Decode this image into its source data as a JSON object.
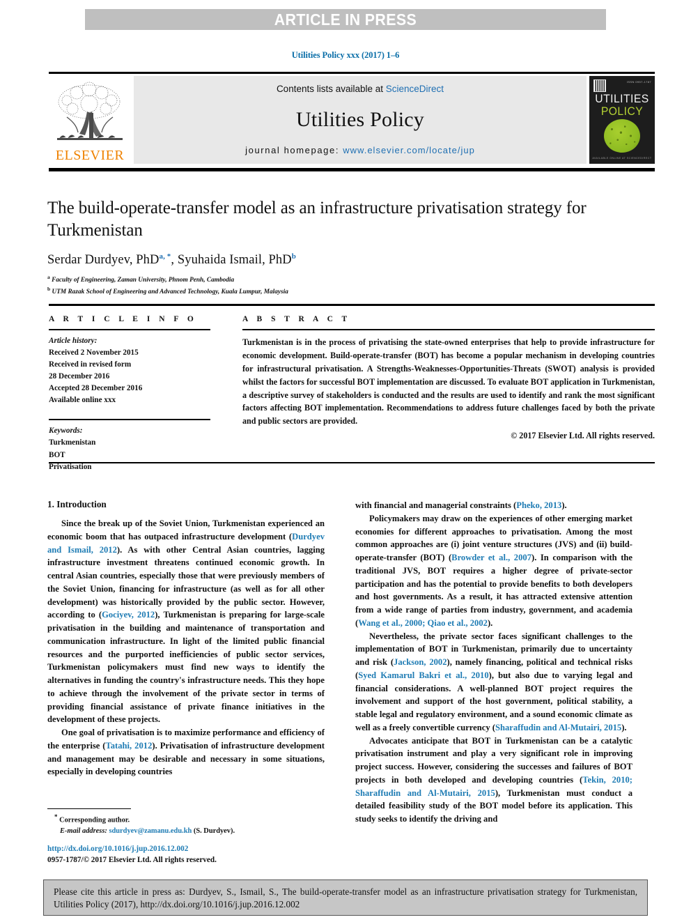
{
  "banner": {
    "text": "ARTICLE IN PRESS"
  },
  "journal_ref": "Utilities Policy xxx (2017) 1–6",
  "masthead": {
    "contents_prefix": "Contents lists available at ",
    "sciencedirect": "ScienceDirect",
    "journal_title": "Utilities Policy",
    "homepage_prefix": "journal homepage: ",
    "homepage_url": "www.elsevier.com/locate/jup",
    "publisher": "ELSEVIER",
    "cover": {
      "line1": "UTILITIES",
      "line2": "POLICY",
      "issn": "ISSN 0957-1787",
      "foot": "AVAILABLE ONLINE AT SCIENCEDIRECT"
    }
  },
  "article": {
    "title": "The build-operate-transfer model as an infrastructure privatisation strategy for Turkmenistan",
    "authors_1": "Serdar Durdyev, PhD",
    "authors_sup_a": "a, *",
    "authors_2": ", Syuhaida Ismail, PhD",
    "authors_sup_b": "b",
    "affiliation_a_mark": "a",
    "affiliation_a": "Faculty of Engineering, Zaman University, Phnom Penh, Cambodia",
    "affiliation_b_mark": "b",
    "affiliation_b": "UTM Razak School of Engineering and Advanced Technology, Kuala Lumpur, Malaysia"
  },
  "info": {
    "heading": "A R T I C L E  I N F O",
    "history_label": "Article history:",
    "history": [
      "Received 2 November 2015",
      "Received in revised form",
      "28 December 2016",
      "Accepted 28 December 2016",
      "Available online xxx"
    ],
    "keywords_label": "Keywords:",
    "keywords": [
      "Turkmenistan",
      "BOT",
      "Privatisation"
    ]
  },
  "abstract": {
    "heading": "A B S T R A C T",
    "text": "Turkmenistan is in the process of privatising the state-owned enterprises that help to provide infrastructure for economic development. Build-operate-transfer (BOT) has become a popular mechanism in developing countries for infrastructural privatisation. A Strengths-Weaknesses-Opportunities-Threats (SWOT) analysis is provided whilst the factors for successful BOT implementation are discussed. To evaluate BOT application in Turkmenistan, a descriptive survey of stakeholders is conducted and the results are used to identify and rank the most significant factors affecting BOT implementation. Recommendations to address future challenges faced by both the private and public sectors are provided.",
    "copyright": "© 2017 Elsevier Ltd. All rights reserved."
  },
  "body": {
    "section_title": "1. Introduction",
    "left_p1_a": "Since the break up of the Soviet Union, Turkmenistan experienced an economic boom that has outpaced infrastructure development (",
    "left_p1_c1": "Durdyev and Ismail, 2012",
    "left_p1_b": "). As with other Central Asian countries, lagging infrastructure investment threatens continued economic growth. In central Asian countries, especially those that were previously members of the Soviet Union, financing for infrastructure (as well as for all other development) was historically provided by the public sector. However, according to (",
    "left_p1_c2": "Gociyev, 2012",
    "left_p1_d": "), Turkmenistan is preparing for large-scale privatisation in the building and maintenance of transportation and communication infrastructure. In light of the limited public financial resources and the purported inefficiencies of public sector services, Turkmenistan policymakers must find new ways to identify the alternatives in funding the country's infrastructure needs. This they hope to achieve through the involvement of the private sector in terms of providing financial assistance of private finance initiatives in the development of these projects.",
    "left_p2_a": "One goal of privatisation is to maximize performance and efficiency of the enterprise (",
    "left_p2_c1": "Tatahi, 2012",
    "left_p2_b": "). Privatisation of infrastructure development and management may be desirable and necessary in some situations, especially in developing countries",
    "right_p0_a": "with financial and managerial constraints (",
    "right_p0_c1": "Pheko, 2013",
    "right_p0_b": ").",
    "right_p1_a": "Policymakers may draw on the experiences of other emerging market economies for different approaches to privatisation. Among the most common approaches are (i) joint venture structures (JVS) and (ii) build-operate-transfer (BOT) (",
    "right_p1_c1": "Browder et al., 2007",
    "right_p1_b": "). In comparison with the traditional JVS, BOT requires a higher degree of private-sector participation and has the potential to provide benefits to both developers and host governments. As a result, it has attracted extensive attention from a wide range of parties from industry, government, and academia (",
    "right_p1_c2": "Wang et al., 2000; Qiao et al., 2002",
    "right_p1_d": ").",
    "right_p2_a": "Nevertheless, the private sector faces significant challenges to the implementation of BOT in Turkmenistan, primarily due to uncertainty and risk (",
    "right_p2_c1": "Jackson, 2002",
    "right_p2_b": "), namely financing, political and technical risks (",
    "right_p2_c2": "Syed Kamarul Bakri et al., 2010",
    "right_p2_c": "), but also due to varying legal and financial considerations. A well-planned BOT project requires the involvement and support of the host government, political stability, a stable legal and regulatory environment, and a sound economic climate as well as a freely convertible currency (",
    "right_p2_c3": "Sharaffudin and Al-Mutairi, 2015",
    "right_p2_d": ").",
    "right_p3_a": "Advocates anticipate that BOT in Turkmenistan can be a catalytic privatisation instrument and play a very significant role in improving project success. However, considering the successes and failures of BOT projects in both developed and developing countries (",
    "right_p3_c1": "Tekin, 2010; Sharaffudin and Al-Mutairi, 2015",
    "right_p3_b": "), Turkmenistan must conduct a detailed feasibility study of the BOT model before its application. This study seeks to identify the driving and"
  },
  "footnote": {
    "star": "*",
    "corresponding": "Corresponding author.",
    "email_label": "E-mail address:",
    "email": "sdurdyev@zamanu.edu.kh",
    "email_suffix": "(S. Durdyev).",
    "doi": "http://dx.doi.org/10.1016/j.jup.2016.12.002",
    "issn_copyright": "0957-1787/© 2017 Elsevier Ltd. All rights reserved."
  },
  "cite_box": {
    "text": "Please cite this article in press as: Durdyev, S., Ismail, S., The build-operate-transfer model as an infrastructure privatisation strategy for Turkmenistan, Utilities Policy (2017), http://dx.doi.org/10.1016/j.jup.2016.12.002"
  },
  "colors": {
    "link": "#1f7cb4",
    "banner_bg": "#bfbfbf",
    "elsevier_orange": "#ef8200",
    "cover_green": "#b5d334"
  }
}
